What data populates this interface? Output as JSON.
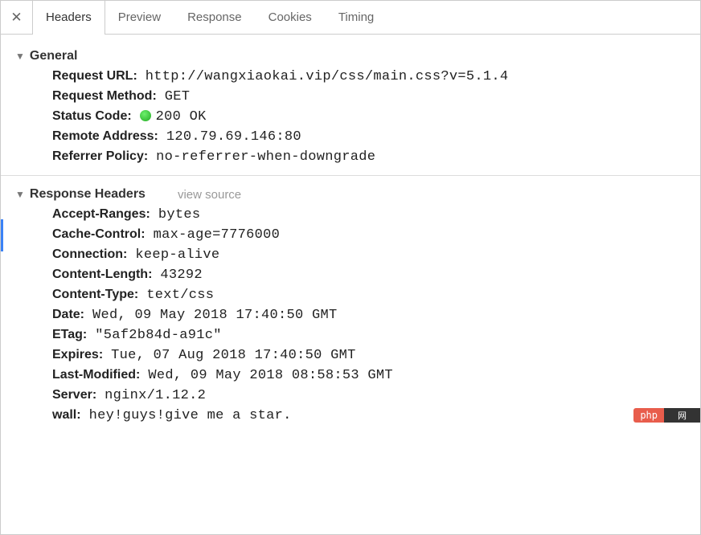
{
  "tabs": {
    "close": "✕",
    "items": [
      "Headers",
      "Preview",
      "Response",
      "Cookies",
      "Timing"
    ],
    "active": 0
  },
  "general": {
    "title": "General",
    "request_url_label": "Request URL:",
    "request_url": "http://wangxiaokai.vip/css/main.css?v=5.1.4",
    "request_method_label": "Request Method:",
    "request_method": "GET",
    "status_code_label": "Status Code:",
    "status_code": "200 OK",
    "remote_address_label": "Remote Address:",
    "remote_address": "120.79.69.146:80",
    "referrer_policy_label": "Referrer Policy:",
    "referrer_policy": "no-referrer-when-downgrade"
  },
  "response_headers": {
    "title": "Response Headers",
    "view_source": "view source",
    "rows": {
      "accept_ranges_label": "Accept-Ranges:",
      "accept_ranges": "bytes",
      "cache_control_label": "Cache-Control:",
      "cache_control": "max-age=7776000",
      "connection_label": "Connection:",
      "connection": "keep-alive",
      "content_length_label": "Content-Length:",
      "content_length": "43292",
      "content_type_label": "Content-Type:",
      "content_type": "text/css",
      "date_label": "Date:",
      "date": "Wed, 09 May 2018 17:40:50 GMT",
      "etag_label": "ETag:",
      "etag": "\"5af2b84d-a91c\"",
      "expires_label": "Expires:",
      "expires": "Tue, 07 Aug 2018 17:40:50 GMT",
      "last_modified_label": "Last-Modified:",
      "last_modified": "Wed, 09 May 2018 08:58:53 GMT",
      "server_label": "Server:",
      "server": "nginx/1.12.2",
      "wall_label": "wall:",
      "wall": "hey!guys!give me a star."
    }
  },
  "watermark": {
    "php": "php",
    "tail": "网"
  }
}
